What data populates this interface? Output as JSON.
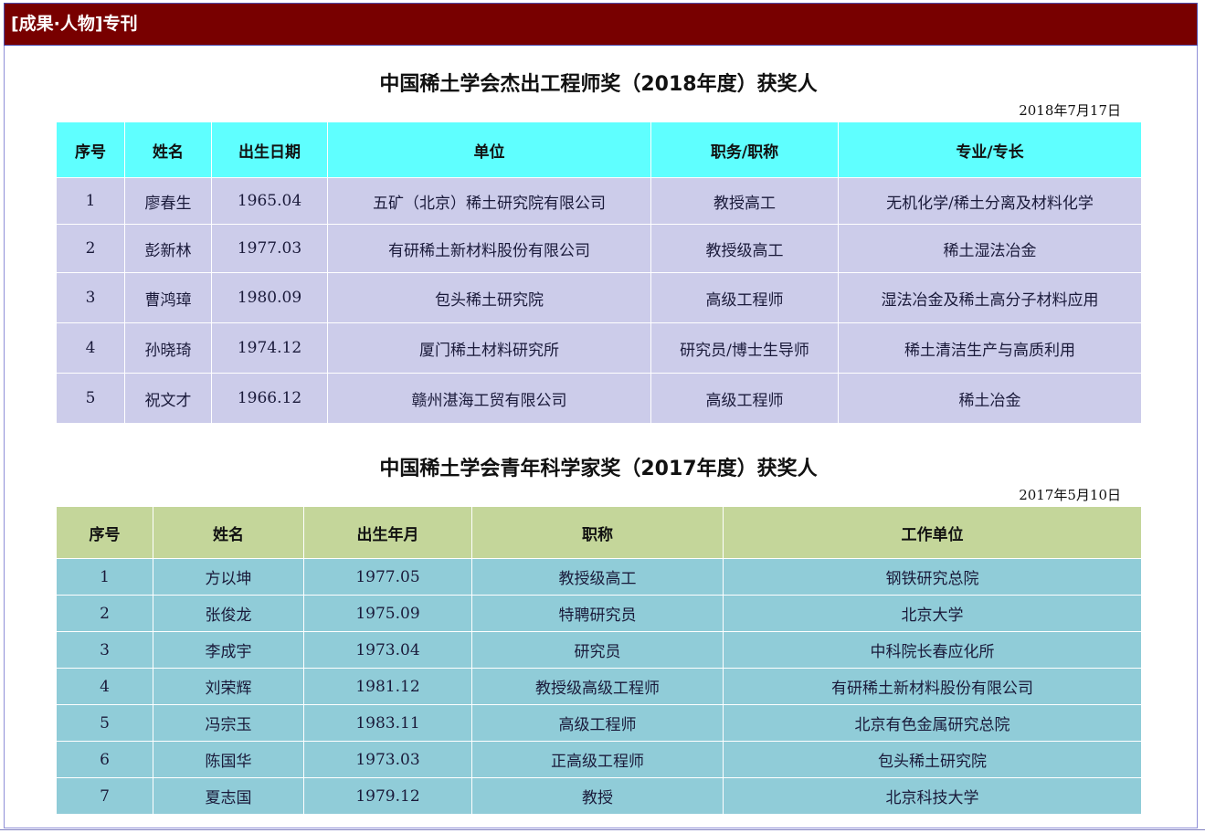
{
  "header": {
    "title": "[成果·人物]专刊"
  },
  "section1": {
    "title": "中国稀土学会杰出工程师奖（2018年度）获奖人",
    "date": "2018年7月17日",
    "columns": [
      "序号",
      "姓名",
      "出生日期",
      "单位",
      "职务/职称",
      "专业/专长"
    ],
    "rows": [
      [
        "1",
        "廖春生",
        "1965.04",
        "五矿（北京）稀土研究院有限公司",
        "教授高工",
        "无机化学/稀土分离及材料化学"
      ],
      [
        "2",
        "彭新林",
        "1977.03",
        "有研稀土新材料股份有限公司",
        "教授级高工",
        "稀土湿法冶金"
      ],
      [
        "3",
        "曹鸿璋",
        "1980.09",
        "包头稀土研究院",
        "高级工程师",
        "湿法冶金及稀土高分子材料应用"
      ],
      [
        "4",
        "孙晓琦",
        "1974.12",
        "厦门稀土材料研究所",
        "研究员/博士生导师",
        "稀土清洁生产与高质利用"
      ],
      [
        "5",
        "祝文才",
        "1966.12",
        "赣州湛海工贸有限公司",
        "高级工程师",
        "稀土冶金"
      ]
    ]
  },
  "section2": {
    "title": "中国稀土学会青年科学家奖（2017年度）获奖人",
    "date": "2017年5月10日",
    "columns": [
      "序号",
      "姓名",
      "出生年月",
      "职称",
      "工作单位"
    ],
    "rows": [
      [
        "1",
        "方以坤",
        "1977.05",
        "教授级高工",
        "钢铁研究总院"
      ],
      [
        "2",
        "张俊龙",
        "1975.09",
        "特聘研究员",
        "北京大学"
      ],
      [
        "3",
        "李成宇",
        "1973.04",
        "研究员",
        "中科院长春应化所"
      ],
      [
        "4",
        "刘荣辉",
        "1981.12",
        "教授级高级工程师",
        "有研稀土新材料股份有限公司"
      ],
      [
        "5",
        "冯宗玉",
        "1983.11",
        "高级工程师",
        "北京有色金属研究总院"
      ],
      [
        "6",
        "陈国华",
        "1973.03",
        "正高级工程师",
        "包头稀土研究院"
      ],
      [
        "7",
        "夏志国",
        "1979.12",
        "教授",
        "北京科技大学"
      ]
    ]
  }
}
